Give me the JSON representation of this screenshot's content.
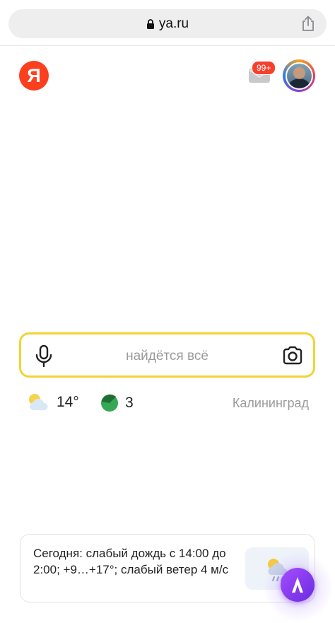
{
  "browser": {
    "url": "ya.ru",
    "lock_icon": "lock-icon",
    "share_icon": "share-icon"
  },
  "header": {
    "logo_letter": "Я",
    "logo_color": "#fc3f1d",
    "mail_icon": "mail-icon",
    "mail_badge": "99+",
    "avatar_icon": "user-avatar"
  },
  "search": {
    "placeholder": "найдётся всё",
    "value": "",
    "accent_color": "#f2d335",
    "mic_icon": "microphone-icon",
    "camera_icon": "camera-icon"
  },
  "info": {
    "weather_icon": "cloudy-sun-icon",
    "temperature": "14°",
    "traffic_icon": "traffic-icon",
    "traffic_score": "3",
    "traffic_color": "#34a853",
    "city": "Калининград"
  },
  "card": {
    "text": "Сегодня: слабый дождь с 14:00 до 2:00; +9…+17°; слабый ветер 4 м/с",
    "image_icon": "rain-cloud-sun-icon"
  },
  "alice": {
    "icon": "alice-icon",
    "color": "#8a3ff0"
  }
}
